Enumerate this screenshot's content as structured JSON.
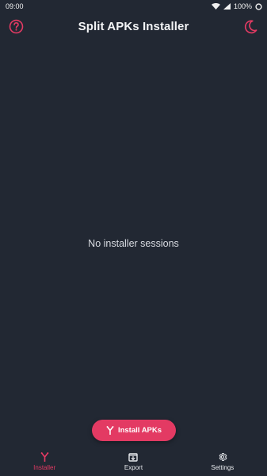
{
  "status_bar": {
    "time": "09:00",
    "battery": "100%"
  },
  "app_bar": {
    "title": "Split APKs Installer",
    "left_icon": "help-icon",
    "right_icon": "moon-icon"
  },
  "main": {
    "empty_message": "No installer sessions"
  },
  "fab": {
    "label": "Install APKs",
    "icon": "install-fork-icon"
  },
  "bottom_nav": {
    "items": [
      {
        "label": "Installer",
        "icon": "installer-icon",
        "active": true
      },
      {
        "label": "Export",
        "icon": "export-icon",
        "active": false
      },
      {
        "label": "Settings",
        "icon": "settings-icon",
        "active": false
      }
    ]
  },
  "colors": {
    "background": "#222833",
    "accent": "#e33a63",
    "text": "#e8eaee"
  }
}
